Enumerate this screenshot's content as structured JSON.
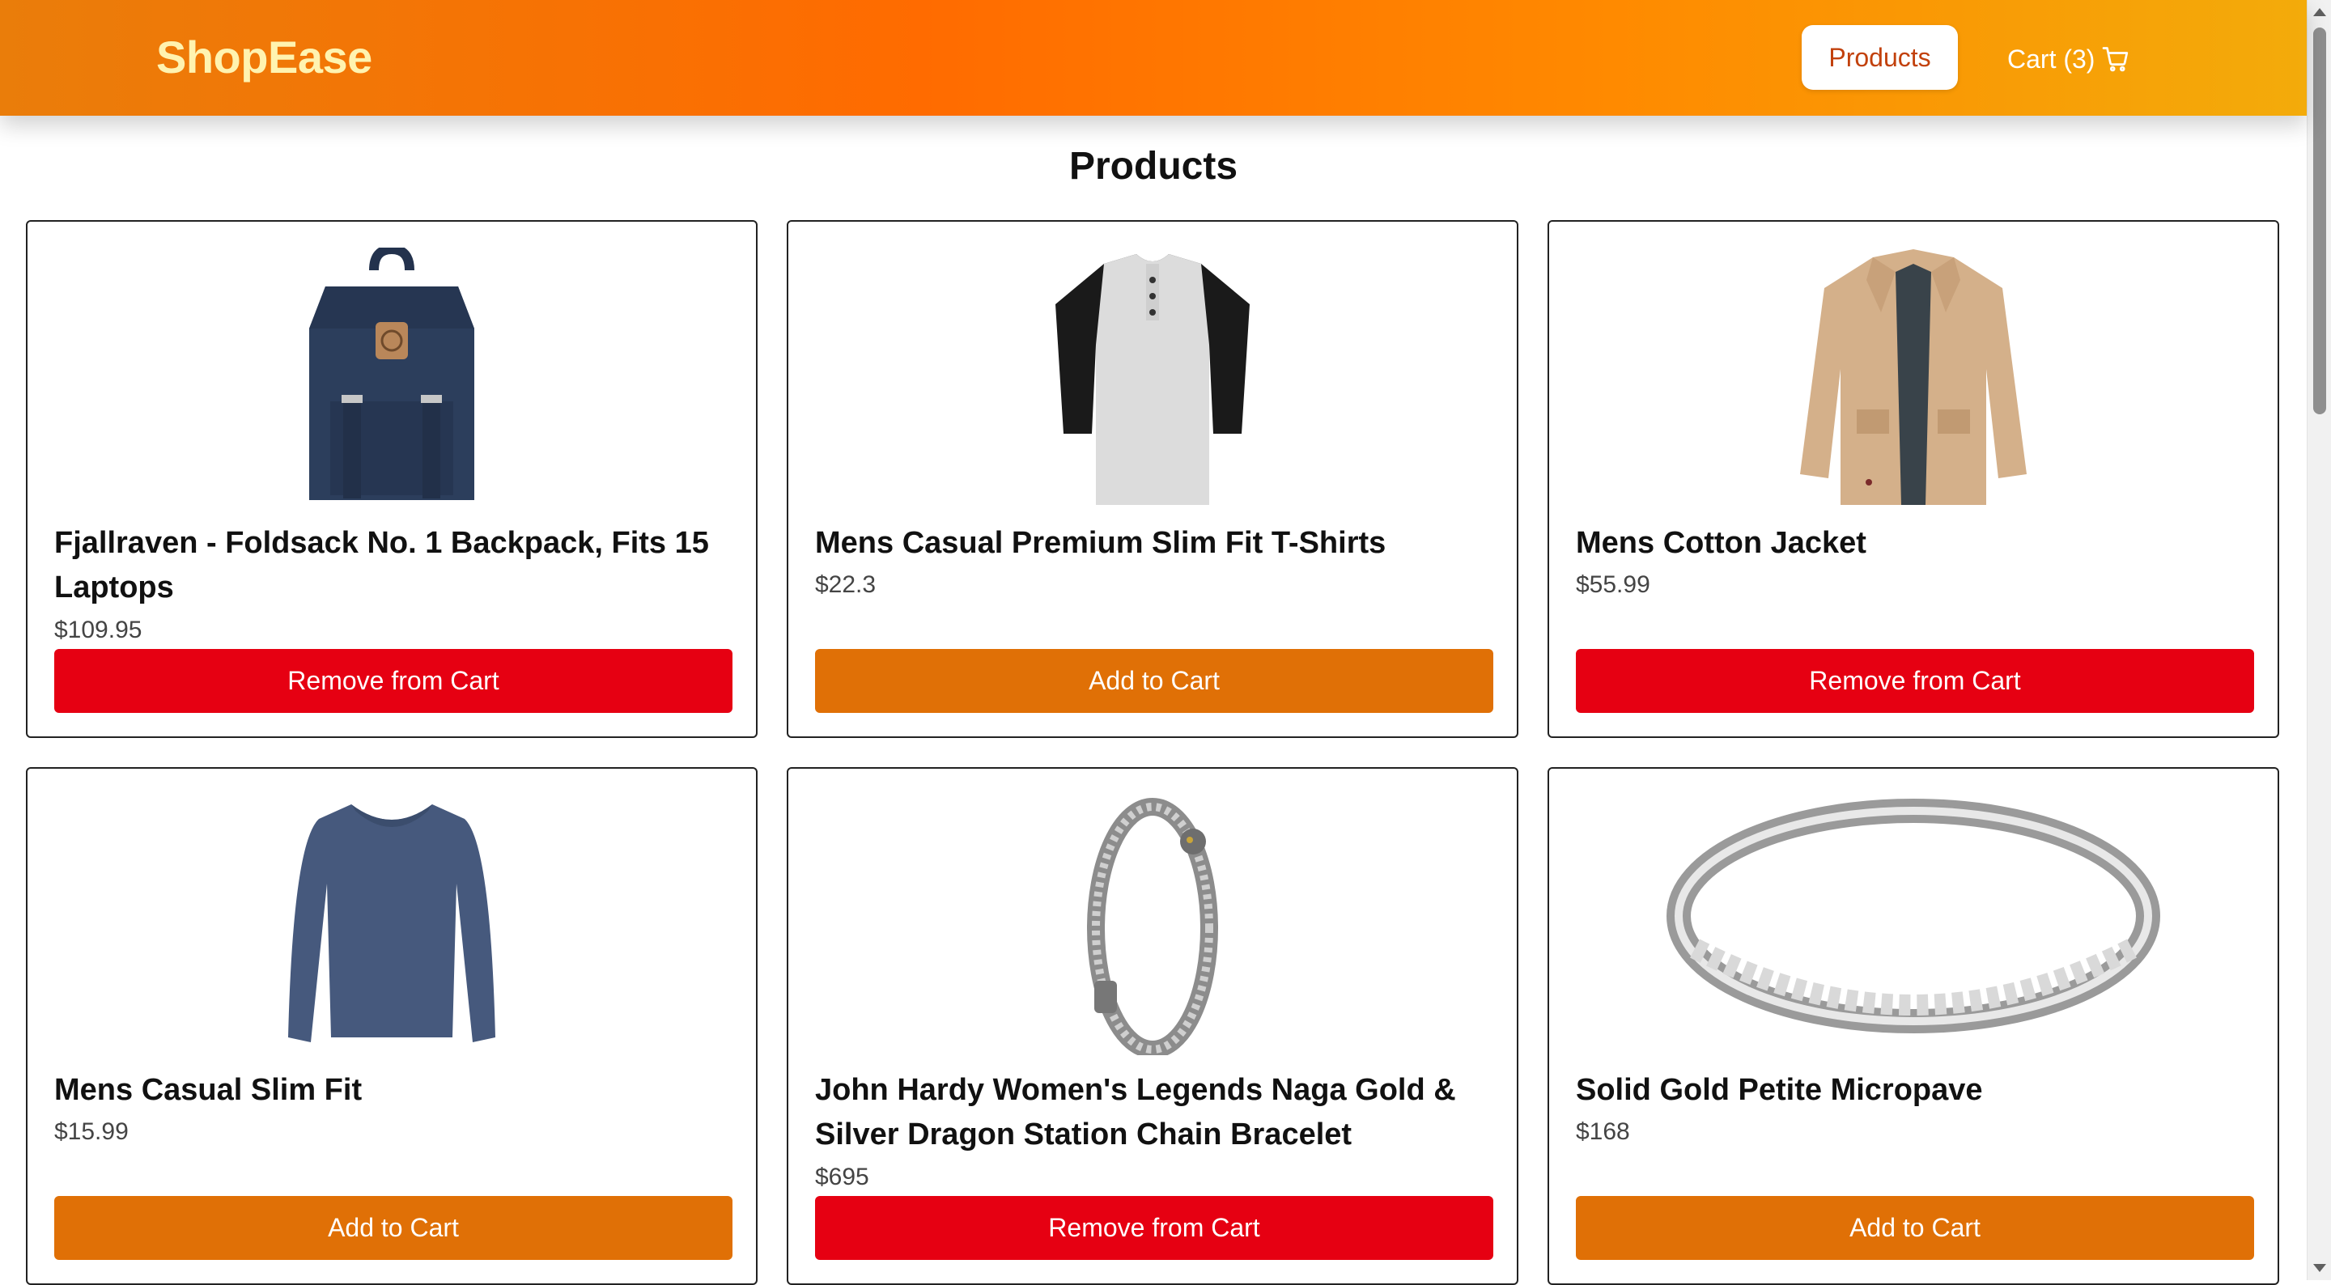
{
  "header": {
    "logo": "ShopEase",
    "nav_products": "Products",
    "nav_cart": "Cart (3)",
    "gradient_colors": [
      "#ea7d0a",
      "#ff6b00",
      "#ff8a00",
      "#f3ab0a"
    ]
  },
  "page": {
    "title": "Products"
  },
  "colors": {
    "remove_button": "#e60012",
    "add_button": "#e07006",
    "logo_text": "#fff3b0",
    "nav_active_text": "#c2410c"
  },
  "products": [
    {
      "title": "Fjallraven - Foldsack No. 1 Backpack, Fits 15 Laptops",
      "price": "$109.95",
      "button": "Remove from Cart",
      "in_cart": true,
      "image": "backpack-image"
    },
    {
      "title": "Mens Casual Premium Slim Fit T-Shirts",
      "price": "$22.3",
      "button": "Add to Cart",
      "in_cart": false,
      "image": "raglan-tshirt-image"
    },
    {
      "title": "Mens Cotton Jacket",
      "price": "$55.99",
      "button": "Remove from Cart",
      "in_cart": true,
      "image": "cotton-jacket-image"
    },
    {
      "title": "Mens Casual Slim Fit",
      "price": "$15.99",
      "button": "Add to Cart",
      "in_cart": false,
      "image": "long-sleeve-shirt-image"
    },
    {
      "title": "John Hardy Women's Legends Naga Gold & Silver Dragon Station Chain Bracelet",
      "price": "$695",
      "button": "Remove from Cart",
      "in_cart": true,
      "image": "dragon-bracelet-image"
    },
    {
      "title": "Solid Gold Petite Micropave",
      "price": "$168",
      "button": "Add to Cart",
      "in_cart": false,
      "image": "micropave-ring-image"
    }
  ]
}
